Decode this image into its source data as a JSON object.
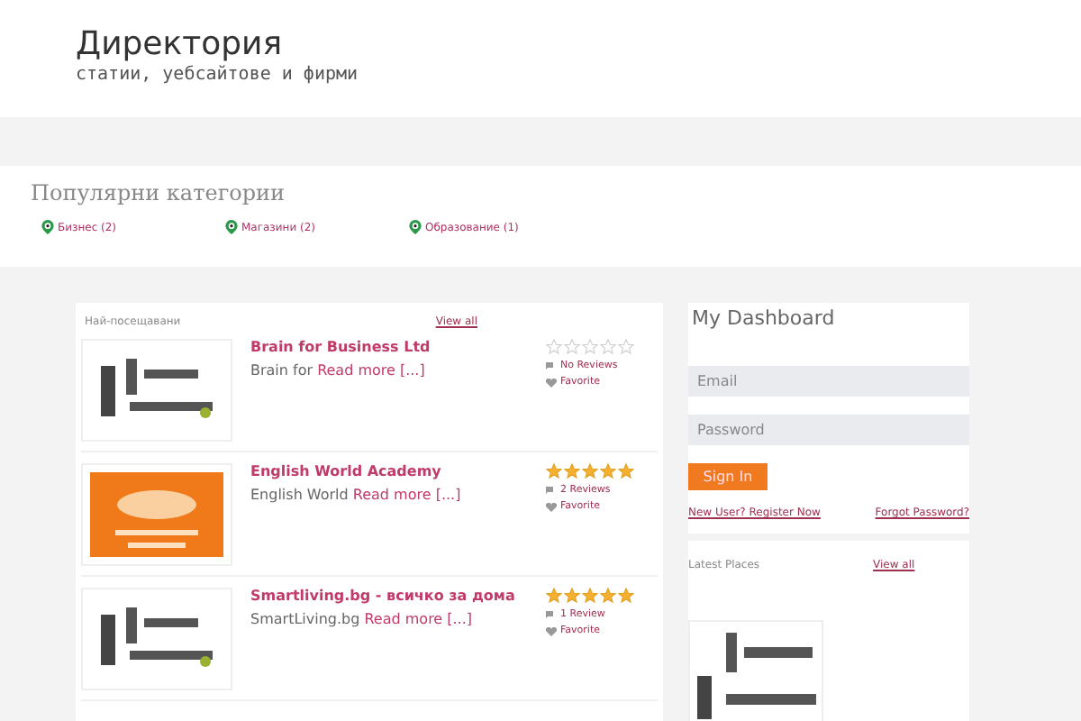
{
  "site": {
    "title": "Директория",
    "tagline": "статии, уебсайтове и фирми"
  },
  "popular": {
    "title": "Популярни категории",
    "categories": [
      {
        "label": "Бизнес (2)"
      },
      {
        "label": "Магазини (2)"
      },
      {
        "label": "Образование (1)"
      }
    ]
  },
  "listings": {
    "title": "Най-посещавани",
    "view_all": "View all",
    "items": [
      {
        "name": "Brain for Business Ltd",
        "excerpt": "Brain for",
        "more": "Read more [...]",
        "stars": 0,
        "reviews": "No Reviews",
        "favorite": "Favorite"
      },
      {
        "name": "English World Academy",
        "excerpt": "English World",
        "more": "Read more [...]",
        "stars": 5,
        "reviews": "2 Reviews",
        "favorite": "Favorite"
      },
      {
        "name": "Smartliving.bg - всичко за дома",
        "excerpt": "SmartLiving.bg",
        "more": "Read more [...]",
        "stars": 5,
        "reviews": "1 Review",
        "favorite": "Favorite"
      }
    ]
  },
  "dashboard": {
    "title": "My Dashboard",
    "email_placeholder": "Email",
    "password_placeholder": "Password",
    "sign_in": "Sign In",
    "register": "New User? Register Now",
    "forgot": "Forgot Password?"
  },
  "latest": {
    "title": "Latest Places",
    "view_all": "View all"
  }
}
